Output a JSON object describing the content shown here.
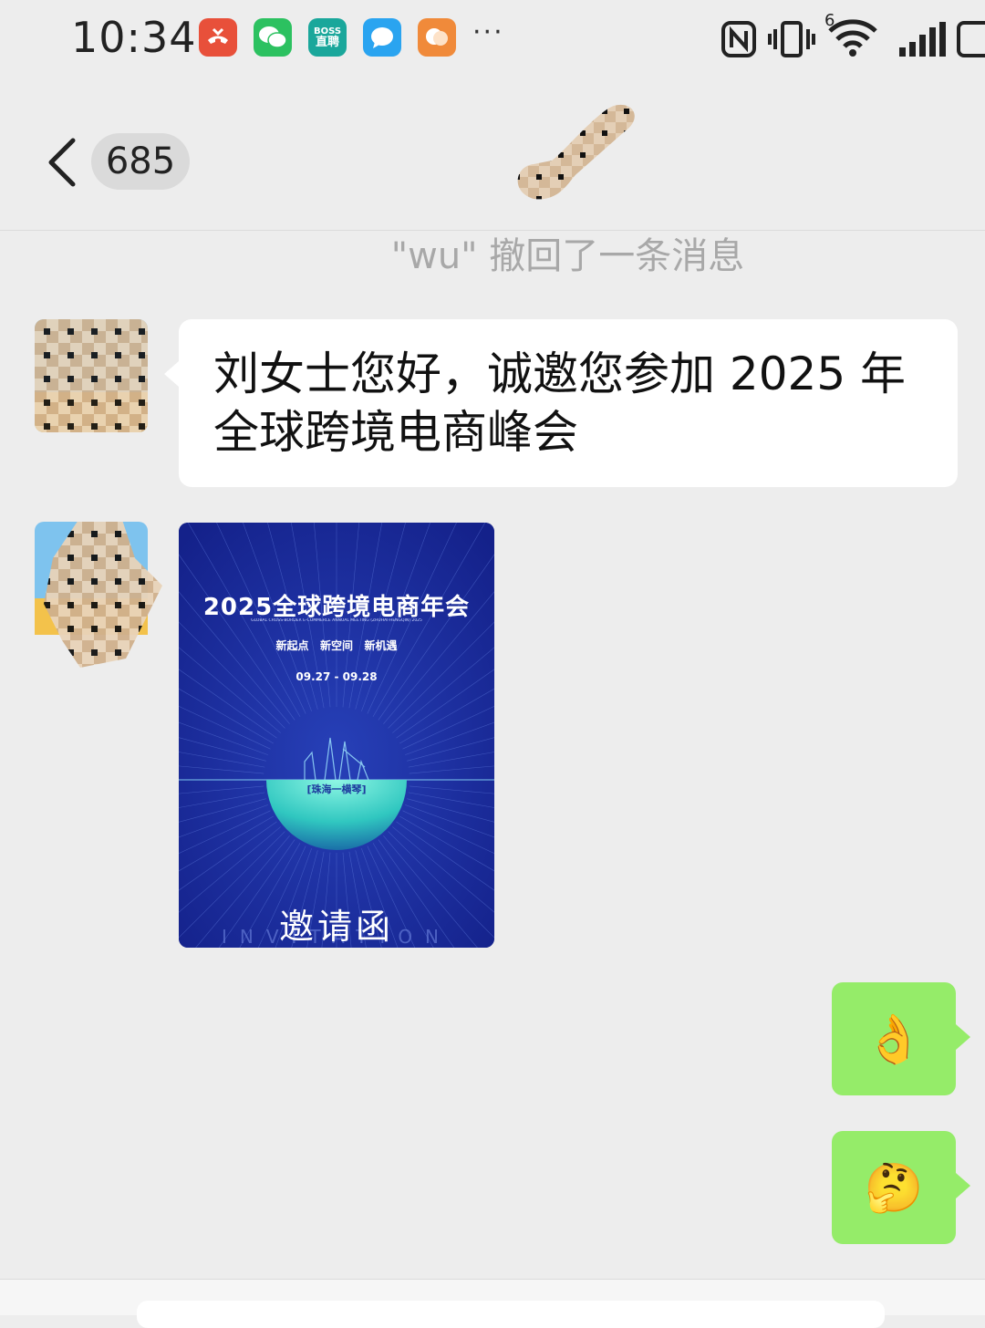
{
  "status_bar": {
    "time": "10:34",
    "notifications": [
      {
        "icon": "missed-call-icon",
        "color": "#e8503a"
      },
      {
        "icon": "wechat-icon",
        "color": "#2cc160"
      },
      {
        "icon": "boss-zhipin-icon",
        "label_top": "BOSS",
        "label_bottom": "直聘",
        "color": "#1aa79b"
      },
      {
        "icon": "message-bubble-icon",
        "color": "#2aa4f0"
      },
      {
        "icon": "chat-app-icon",
        "color": "#f08a3a"
      }
    ],
    "more": "···",
    "network_label": "6"
  },
  "nav": {
    "unread_count": "685",
    "title_visible_fragment": "u"
  },
  "system_message": "\"wu\" 撤回了一条消息",
  "messages": {
    "text_line1": "刘女士您好，诚邀您参加 2025 年",
    "text_line2": "全球跨境电商峰会",
    "poster": {
      "title": "2025全球跨境电商年会",
      "subtitle": "GLOBAL CROSS-BORDER E-COMMERCE ANNUAL MEETING (ZHUHAI·HENGQIN) 2025",
      "slogan": "新起点   新空间   新机遇",
      "dates": "09.27 - 09.28",
      "location": "[珠海一横琴]",
      "invitation": "邀请函",
      "invitation_en": "INVITATION"
    },
    "reply1": "👌",
    "reply2": "🤔"
  },
  "colors": {
    "background": "#ededed",
    "outgoing_bubble": "#95ec69",
    "incoming_bubble": "#ffffff",
    "poster_blue": "#1a2a8c",
    "poster_glow": "#3fe0c8"
  }
}
